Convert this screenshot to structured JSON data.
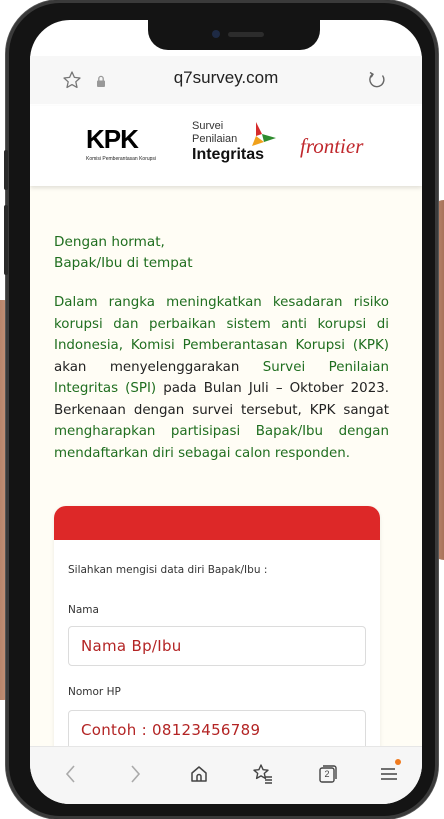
{
  "browser": {
    "url": "q7survey.com",
    "icons": {
      "favorite": "star-icon",
      "lock": "lock-icon",
      "reload": "reload-icon"
    }
  },
  "logos": {
    "kpk": {
      "main": "KPK",
      "sub": "Komisi Pemberantasan Korupsi"
    },
    "spi": {
      "line1": "Survei",
      "line2": "Penilaian",
      "line3": "Integritas"
    },
    "frontier": "frontier"
  },
  "letter": {
    "greeting_line1": "Dengan hormat,",
    "greeting_line2": "Bapak/Ibu di tempat",
    "p1": "Dalam rangka meningkatkan kesadaran risiko korupsi dan perbaikan sistem anti korupsi di Indonesia, Komisi Pemberantasan Korupsi (KPK)",
    "p2": "akan menyelenggarakan",
    "p3": "Survei Penilaian Integritas (SPI)",
    "p4": "pada Bulan Juli – Oktober 2023.",
    "p5": "Berkenaan dengan survei tersebut, KPK sangat",
    "p6": "mengharapkan partisipasi Bapak/Ibu dengan mendaftarkan diri sebagai calon responden."
  },
  "form": {
    "intro": "Silahkan mengisi data diri Bapak/Ibu :",
    "name_label": "Nama",
    "name_placeholder": "Nama Bp/Ibu",
    "phone_label": "Nomor HP",
    "phone_placeholder": "Contoh : 08123456789"
  },
  "nav": {
    "back_icon": "chevron-left-icon",
    "forward_icon": "chevron-right-icon",
    "home_icon": "home-icon",
    "favorites_icon": "favorites-icon",
    "tabs_count": "2",
    "menu_icon": "menu-icon"
  },
  "colors": {
    "letter_green": "#1f6e1f",
    "form_red": "#dd2828",
    "placeholder_red": "#b32424",
    "frontier_red": "#c0282d",
    "menu_badge": "#f07a1e"
  }
}
